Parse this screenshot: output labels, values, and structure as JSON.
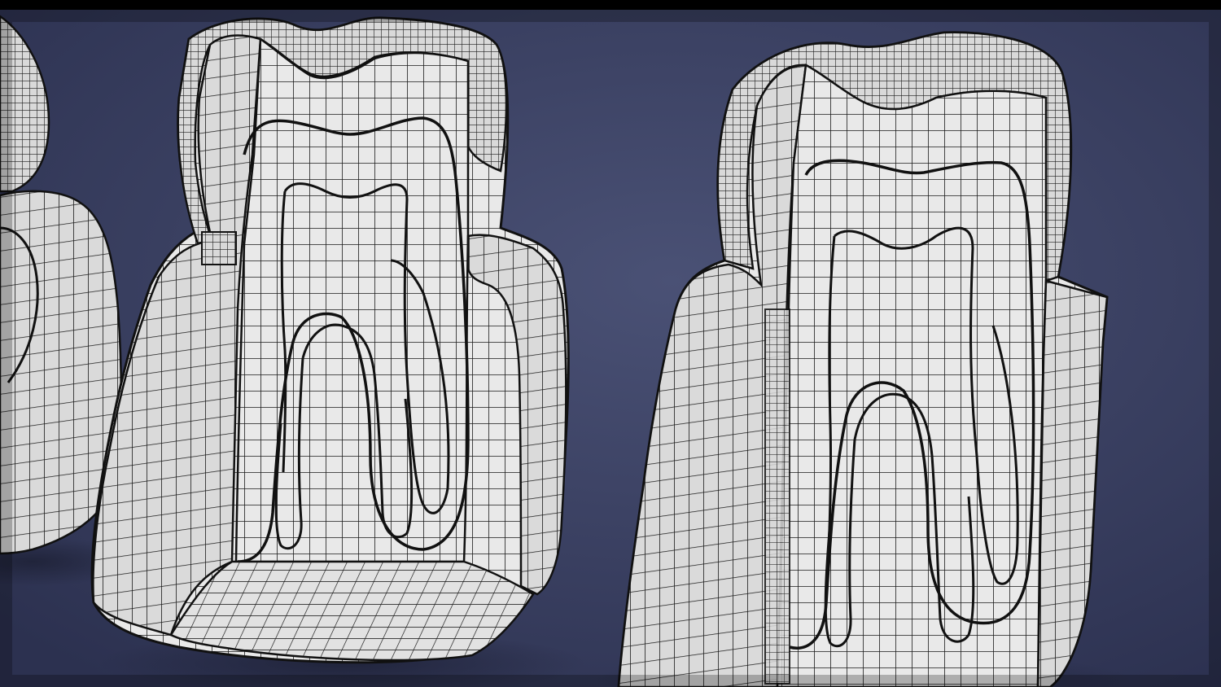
{
  "scene": {
    "subject": "",
    "colors": {
      "background": "#3e4466",
      "background_dark": "#2a2f4a",
      "mesh_fill": "#e6e6e6",
      "mesh_shadow": "#b9b9b9",
      "wire": "#1b1b1b",
      "letterbox": "#000000"
    },
    "objects": [
      {
        "name": "tooth-left-partial",
        "mesh_density": "medium"
      },
      {
        "name": "tooth-center",
        "mesh_density": "medium"
      },
      {
        "name": "tooth-right",
        "mesh_density": "medium"
      }
    ]
  }
}
